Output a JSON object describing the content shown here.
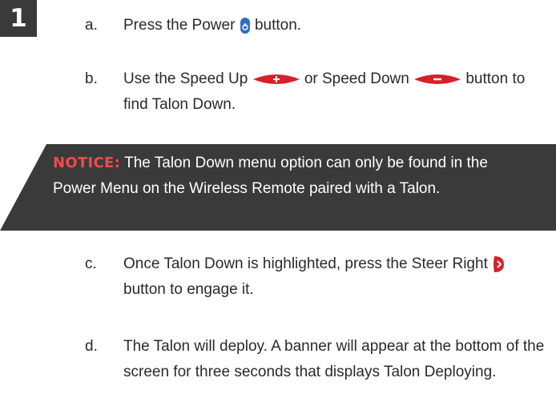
{
  "step": {
    "number": "1"
  },
  "items": [
    {
      "letter": "a.",
      "before": "Press the Power",
      "after": "button."
    },
    {
      "letter": "b.",
      "before": "Use the Speed Up",
      "middle": "or Speed Down",
      "after": "button to find Talon Down."
    },
    {
      "letter": "c.",
      "before": "Once Talon Down is highlighted, press the Steer Right",
      "after": "button to engage it."
    },
    {
      "letter": "d.",
      "text": "The Talon will deploy. A banner will appear at the bottom of the screen for three seconds that displays Talon Deploying."
    }
  ],
  "notice": {
    "label": "NOTICE:",
    "text": "The Talon Down menu option can only be found in the Power Menu on the Wireless Remote paired with a Talon."
  },
  "icons": {
    "power_button": "power-button-icon",
    "speed_up_button": "speed-up-button-icon",
    "speed_down_button": "speed-down-button-icon",
    "steer_right_button": "steer-right-button-icon"
  },
  "colors": {
    "badge_bg": "#3a3a3a",
    "notice_bg": "#3a3a3a",
    "notice_label": "#f04b4b",
    "button_red": "#d81f2a",
    "power_blue": "#2d6fc4"
  }
}
